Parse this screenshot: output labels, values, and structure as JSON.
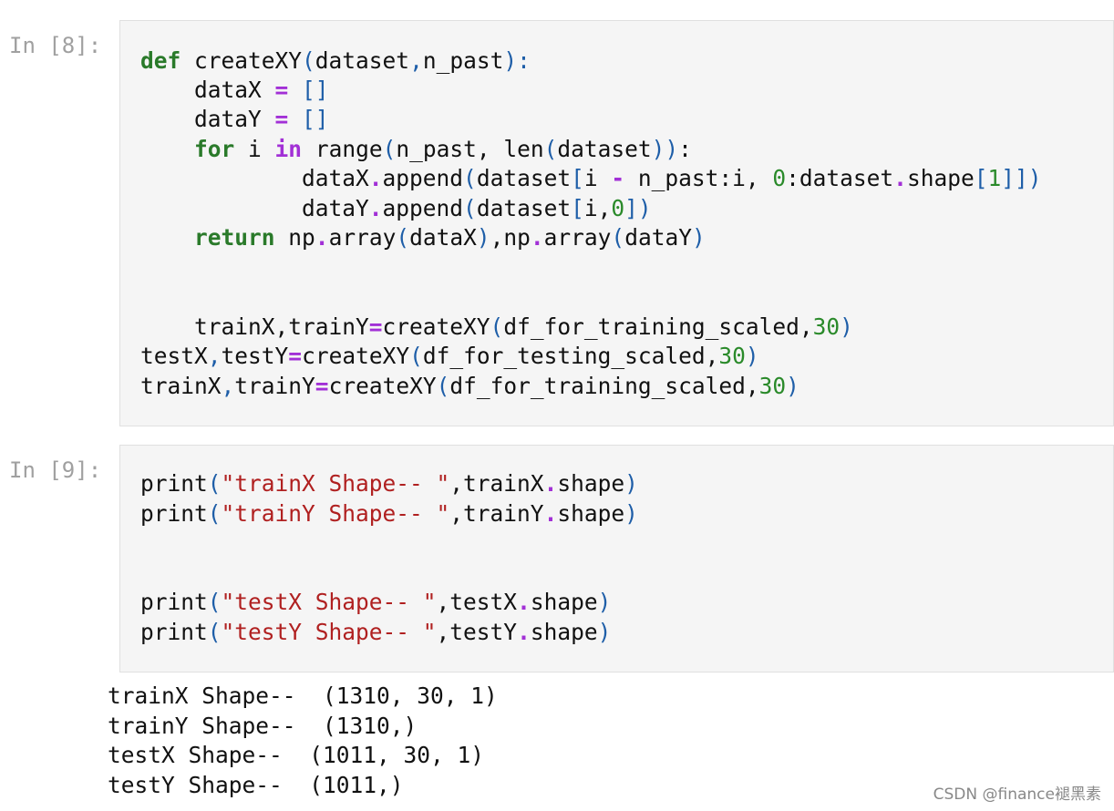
{
  "cells": [
    {
      "prompt": "In [8]:"
    },
    {
      "prompt": "In [9]:"
    }
  ],
  "code": {
    "l1": [
      "def",
      " createXY",
      "(",
      "dataset",
      ",",
      "n_past",
      "):"
    ],
    "l2": [
      "    dataX ",
      "=",
      " ",
      "[]"
    ],
    "l3": [
      "    dataY ",
      "=",
      " ",
      "[]"
    ],
    "l4": [
      "    ",
      "for",
      " i ",
      "in",
      " range",
      "(",
      "n_past, len",
      "(",
      "dataset",
      "))",
      ":"
    ],
    "l5": [
      "            dataX",
      ".",
      "append",
      "(",
      "dataset",
      "[",
      "i ",
      "-",
      " n_past:i, ",
      "0",
      ":dataset",
      ".",
      "shape",
      "[",
      "1",
      "]])"
    ],
    "l6": [
      "            dataY",
      ".",
      "append",
      "(",
      "dataset",
      "[",
      "i,",
      "0",
      "])"
    ],
    "l7": [
      "    ",
      "return",
      " np",
      ".",
      "array",
      "(",
      "dataX",
      ")",
      ",np",
      ".",
      "array",
      "(",
      "dataY",
      ")"
    ],
    "l8": [
      "    trainX,trainY",
      "=",
      "createXY",
      "(",
      "df_for_training_scaled,",
      "30",
      ")"
    ],
    "l9": [
      "testX",
      ",",
      "testY",
      "=",
      "createXY",
      "(",
      "df_for_testing_scaled,",
      "30",
      ")"
    ],
    "l10": [
      "trainX",
      ",",
      "trainY",
      "=",
      "createXY",
      "(",
      "df_for_training_scaled,",
      "30",
      ")"
    ]
  },
  "code2": {
    "l1": [
      "print",
      "(",
      "\"trainX Shape-- \"",
      ",trainX",
      ".",
      "shape",
      ")"
    ],
    "l2": [
      "print",
      "(",
      "\"trainY Shape-- \"",
      ",trainY",
      ".",
      "shape",
      ")"
    ],
    "l3": [
      "print",
      "(",
      "\"testX Shape-- \"",
      ",testX",
      ".",
      "shape",
      ")"
    ],
    "l4": [
      "print",
      "(",
      "\"testY Shape-- \"",
      ",testY",
      ".",
      "shape",
      ")"
    ]
  },
  "output": [
    "trainX Shape--  (1310, 30, 1)",
    "trainY Shape--  (1310,)",
    "testX Shape--  (1011, 30, 1)",
    "testY Shape--  (1011,)"
  ],
  "watermark": "CSDN @finance褪黑素"
}
